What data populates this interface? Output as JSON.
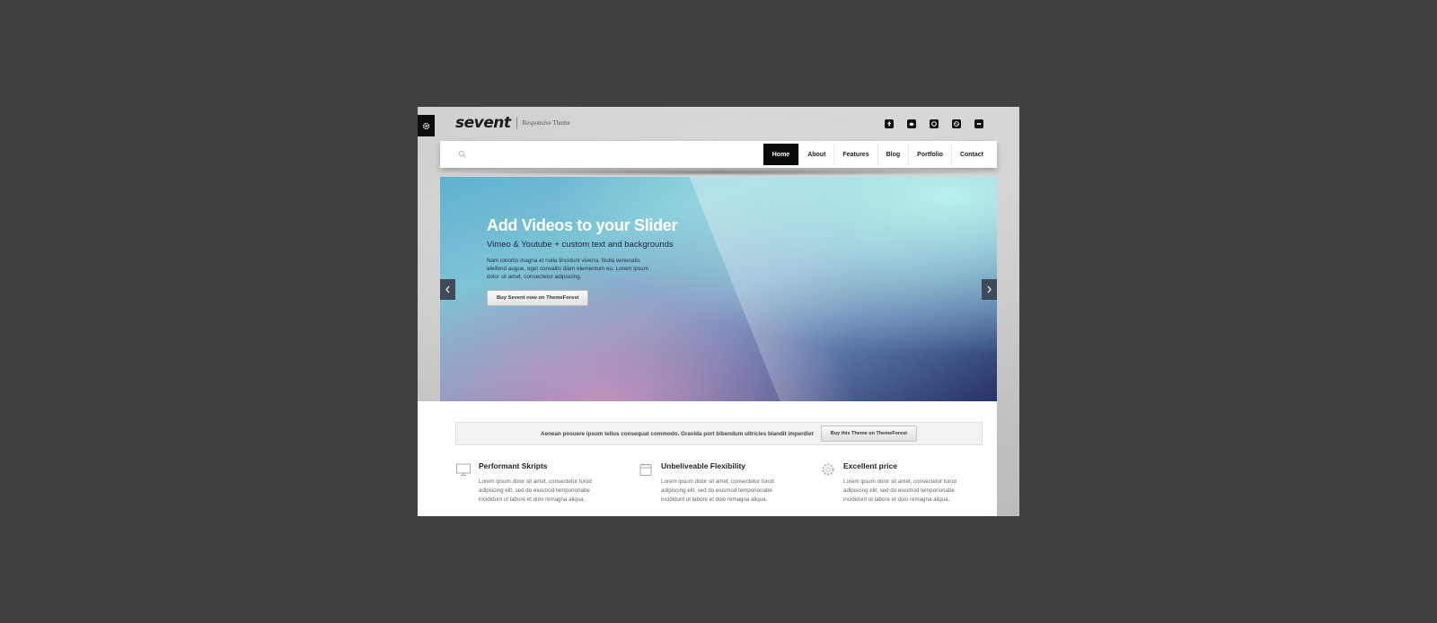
{
  "header": {
    "logo": "sevent",
    "tagline": "Responsive Theme",
    "settings_icon": "gear-icon",
    "socials": [
      "facebook-icon",
      "twitter-icon",
      "skype-icon",
      "dribbble-icon",
      "flickr-icon"
    ]
  },
  "nav": {
    "search_icon": "search-icon",
    "items": [
      {
        "label": "Home",
        "active": true
      },
      {
        "label": "About",
        "active": false
      },
      {
        "label": "Features",
        "active": false
      },
      {
        "label": "Blog",
        "active": false
      },
      {
        "label": "Portfolio",
        "active": false
      },
      {
        "label": "Contact",
        "active": false
      }
    ]
  },
  "slider": {
    "title": "Add Videos to your Slider",
    "subtitle": "Vimeo & Youtube + custom text and backgrounds",
    "body": "Nam lobortis magna et nulla tincidunt viverra. Nulla venenatis eleifend augue, eget convallis diam elementum eu. Lorem ipsum dolor sit amet, consectetur adipiscing.",
    "button": "Buy Sevent now on ThemeForest",
    "prev_icon": "chevron-left-icon",
    "next_icon": "chevron-right-icon"
  },
  "promo": {
    "text": "Aenean posuere ipsum tellus consequat commodo. Gravida port bibendum ultricies blandit imperdiet",
    "button": "Buy this Theme on ThemeForest"
  },
  "features": [
    {
      "title": "Performant Skripts",
      "icon": "monitor-icon",
      "desc": "Lorem ipsum dolor sit amet, consectetur turod adipiscing elit, sed do eiusmod temporionabe incididunt ut labore et dolo remagna aliqua."
    },
    {
      "title": "Unbeliveable Flexibility",
      "icon": "calendar-icon",
      "desc": "Lorem ipsum dolor sit amet, consectetur turod adipiscing elit, sed do eiusmod temporionabe incididunt ut labore et dolo remagna aliqua."
    },
    {
      "title": "Excellent price",
      "icon": "gear-icon",
      "desc": "Lorem ipsum dolor sit amet, consectetur turod adipiscing elit, sed do eiusmod temporionabe incididunt ut labore et dolo remagna aliqua."
    }
  ],
  "colors": {
    "page_background": "#404040",
    "active_nav": "#0a0a0a",
    "slider_start": "#5fb1cf",
    "slider_end": "#223066"
  }
}
